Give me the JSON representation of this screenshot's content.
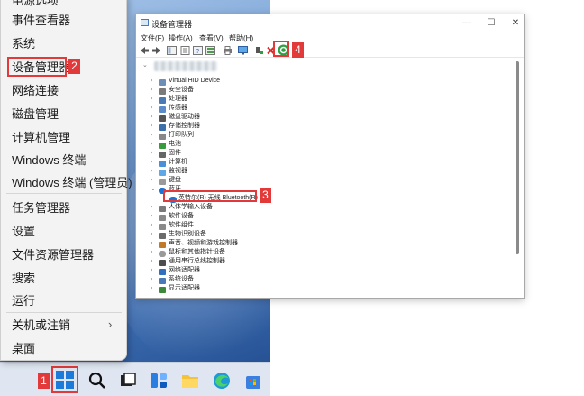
{
  "menu": {
    "items": [
      {
        "label": "电源选项"
      },
      {
        "label": "事件查看器"
      },
      {
        "label": "系统"
      },
      {
        "label": "设备管理器"
      },
      {
        "label": "网络连接"
      },
      {
        "label": "磁盘管理"
      },
      {
        "label": "计算机管理"
      },
      {
        "label": "Windows 终端"
      },
      {
        "label": "Windows 终端 (管理员)"
      },
      {
        "label": "任务管理器"
      },
      {
        "label": "设置"
      },
      {
        "label": "文件资源管理器"
      },
      {
        "label": "搜索"
      },
      {
        "label": "运行"
      },
      {
        "label": "关机或注销"
      },
      {
        "label": "桌面"
      }
    ],
    "submenu_arrow": "›"
  },
  "steps": {
    "one": "1",
    "two": "2",
    "three": "3",
    "four": "4"
  },
  "window": {
    "title": "设备管理器",
    "minimize": "—",
    "maximize": "☐",
    "close": "✕",
    "menus": [
      "文件(F)",
      "操作(A)",
      "查看(V)",
      "帮助(H)"
    ]
  },
  "tree": {
    "expanded_arrow": "⌄",
    "collapsed_arrow": "›",
    "categories": [
      {
        "label": "Virtual HID Device"
      },
      {
        "label": "安全设备"
      },
      {
        "label": "处理器"
      },
      {
        "label": "传感器"
      },
      {
        "label": "磁盘驱动器"
      },
      {
        "label": "存储控制器"
      },
      {
        "label": "打印队列"
      },
      {
        "label": "电池"
      },
      {
        "label": "固件"
      },
      {
        "label": "计算机"
      },
      {
        "label": "监视器"
      },
      {
        "label": "键盘"
      },
      {
        "label": "蓝牙"
      },
      {
        "label": "英特尔(R) 无线 Bluetooth(R)"
      },
      {
        "label": "人体学输入设备"
      },
      {
        "label": "软件设备"
      },
      {
        "label": "软件组件"
      },
      {
        "label": "生物识别设备"
      },
      {
        "label": "声音、视频和游戏控制器"
      },
      {
        "label": "鼠标和其他指针设备"
      },
      {
        "label": "通用串行总线控制器"
      },
      {
        "label": "网络适配器"
      },
      {
        "label": "系统设备"
      },
      {
        "label": "显示适配器"
      }
    ]
  },
  "colors": {
    "step_badge": "#e23a3a",
    "highlight": "#e23a3a",
    "scan_button": "#2ea043"
  }
}
